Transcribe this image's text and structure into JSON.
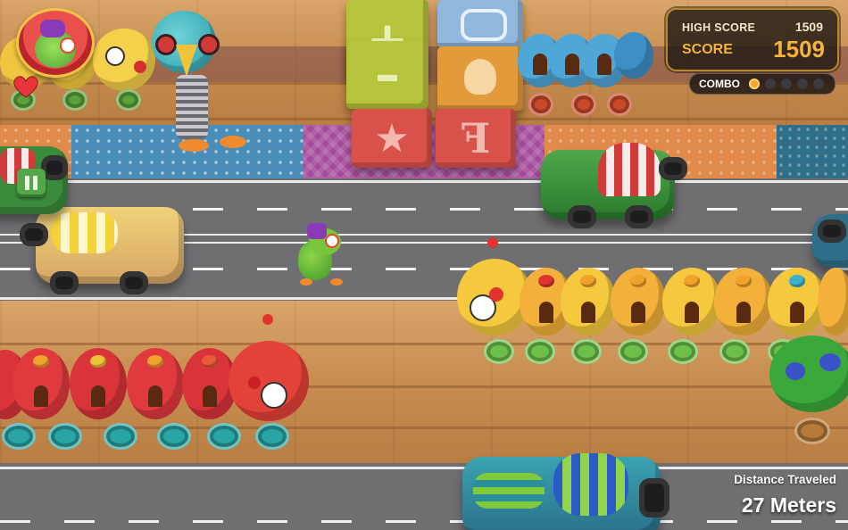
{
  "hud": {
    "high_score_label": "HIGH SCORE",
    "high_score_value": "1509",
    "score_label": "SCORE",
    "score_value": "1509",
    "combo_label": "COMBO",
    "combo_filled": 1,
    "combo_total": 5,
    "lives": 1,
    "distance_label": "Distance Traveled",
    "distance_value": "27 Meters"
  },
  "colors": {
    "hud_gold": "#f4b33a",
    "hud_border": "#b8862c",
    "pause_green": "#54a64a",
    "heart_red": "#e8343a"
  },
  "icons": {
    "player_portrait": "frog-portrait-icon",
    "life": "heart-icon",
    "pause": "pause-icon"
  },
  "scene": {
    "blocks": [
      {
        "glyph": "+",
        "color": "#b5c43a"
      },
      {
        "glyph": "–",
        "color": "#b5c43a"
      },
      {
        "glyph": "★",
        "color": "#d9524a"
      },
      {
        "glyph": "F",
        "color": "#d9524a"
      }
    ]
  }
}
